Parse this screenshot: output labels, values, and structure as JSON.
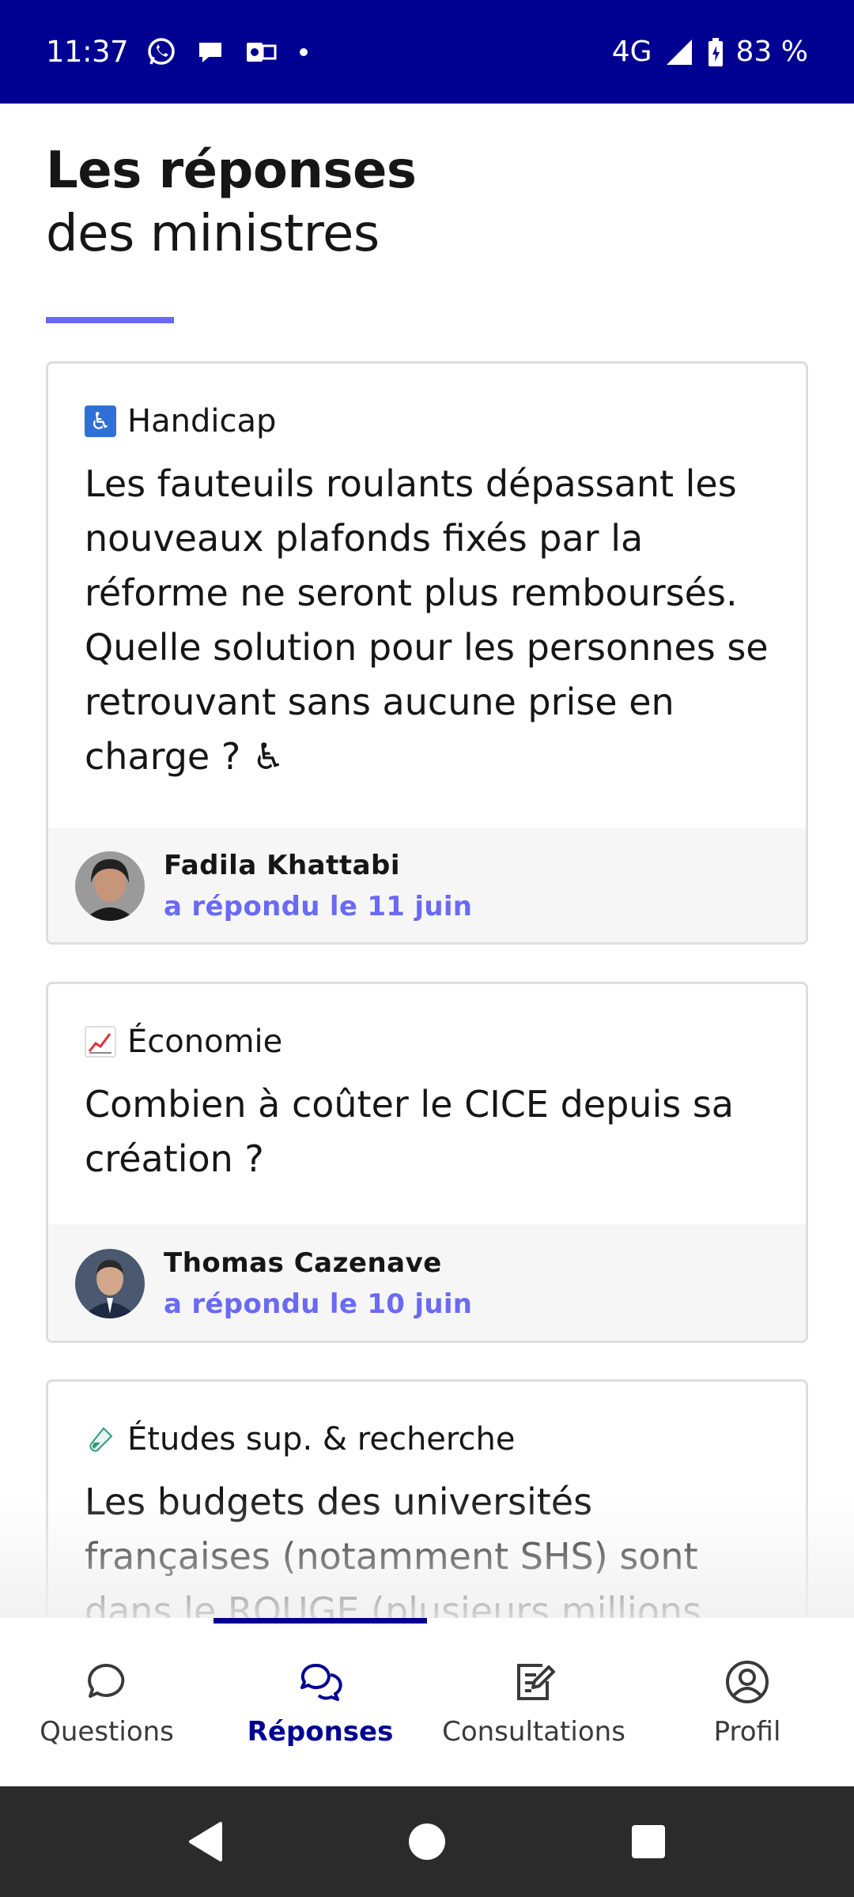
{
  "status_bar": {
    "time": "11:37",
    "network": "4G",
    "battery": "83 %"
  },
  "header": {
    "title_bold": "Les réponses",
    "title_light": "des ministres"
  },
  "cards": [
    {
      "category_icon": "wheelchair-icon",
      "category": "Handicap",
      "question": "Les fauteuils roulants dépassant les nouveaux plafonds fixés par la réforme ne seront plus remboursés. Quelle solution pour les personnes se retrouvant sans aucune prise en charge ? ♿",
      "minister": "Fadila Khattabi",
      "answered": "a répondu le 11 juin"
    },
    {
      "category_icon": "chart-increasing-icon",
      "category": "Économie",
      "question": "Combien à coûter le CICE depuis sa création ?",
      "minister": "Thomas Cazenave",
      "answered": "a répondu le 10 juin"
    },
    {
      "category_icon": "test-tube-icon",
      "category": "Études sup. & recherche",
      "question": "Les budgets des universités françaises (notamment SHS) sont dans le ROUGE (plusieurs millions d'euros) du"
    }
  ],
  "bottom_nav": {
    "items": [
      {
        "label": "Questions",
        "icon": "speech-bubble-icon"
      },
      {
        "label": "Réponses",
        "icon": "conversation-icon",
        "active": true
      },
      {
        "label": "Consultations",
        "icon": "edit-form-icon"
      },
      {
        "label": "Profil",
        "icon": "user-circle-icon"
      }
    ]
  },
  "colors": {
    "brand_blue": "#000091",
    "accent_purple": "#6a6af4"
  }
}
